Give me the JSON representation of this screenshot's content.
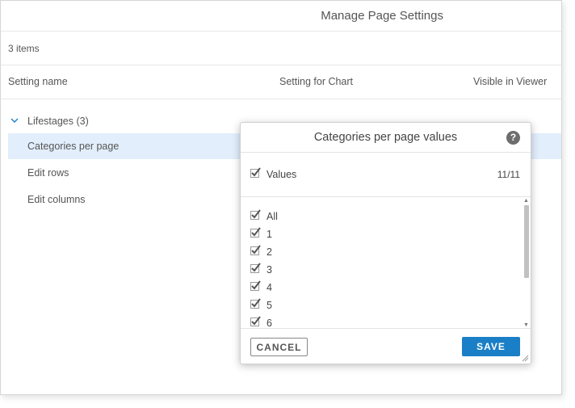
{
  "page": {
    "title": "Manage Page Settings",
    "items_count": "3 items",
    "columns": [
      "Setting name",
      "Setting for Chart",
      "Visible in Viewer"
    ],
    "group": {
      "label": "Lifestages (3)",
      "icon": "chevron-down-icon"
    },
    "rows": [
      "Categories per page",
      "Edit rows",
      "Edit columns"
    ],
    "selected_row": "Categories per page",
    "selected_row_color": "#e2eefb"
  },
  "modal": {
    "title": "Categories per page values",
    "help_icon_label": "?",
    "values_label": "Values",
    "values_count": "11/11",
    "items": [
      "All",
      "1",
      "2",
      "3",
      "4",
      "5",
      "6"
    ],
    "cancel_label": "CANCEL",
    "save_label": "SAVE",
    "save_color": "#1a7fc6"
  }
}
